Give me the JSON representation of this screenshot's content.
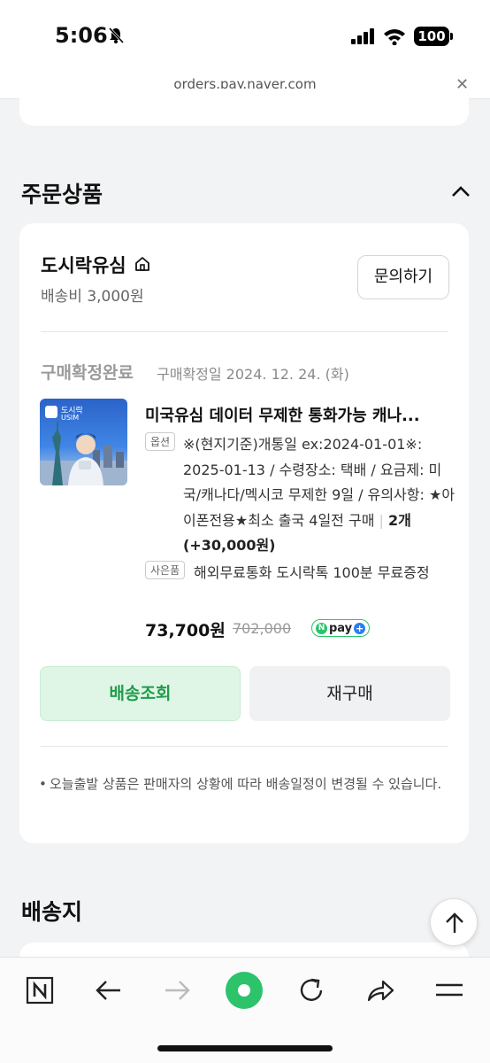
{
  "status_bar": {
    "time": "5:06",
    "battery": "100"
  },
  "browser": {
    "url": "orders.pay.naver.com"
  },
  "section": {
    "ordered_items": "주문상품",
    "delivery": "배송지"
  },
  "seller": {
    "name": "도시락유심",
    "shipping": "배송비 3,000원",
    "inquiry_label": "문의하기"
  },
  "order": {
    "status": "구매확정완료",
    "status_date": "구매확정일 2024. 12. 24. (화)",
    "thumb_brand": "도시락",
    "thumb_sub": "USIM",
    "product_name": "미국유심 데이터 무제한 통화가능 캐나...",
    "option_tag": "옵션",
    "option_text": "※(현지기준)개통일 ex:2024-01-01※: 2025-01-13 / 수령장소: 택배 / 요금제: 미국/캐나다/멕시코 무제한 9일 / 유의사항: ★아이폰전용★최소 출국 4일전 구매",
    "quantity": "2개 (+30,000원)",
    "gift_tag": "사은품",
    "gift_text": "해외무료통화 도시락톡 100분 무료증정",
    "price": "73,700원",
    "original_price": "702,000",
    "npay_label": "pay"
  },
  "actions": {
    "track_label": "배송조회",
    "rebuy_label": "재구매"
  },
  "notice": "오늘출발 상품은 판매자의 상황에 따라 배송일정이 변경될 수 있습니다.",
  "colors": {
    "green": "#2cc36b",
    "track_text": "#1f9d4a",
    "track_bg": "#dff6e6",
    "page_bg": "#f2f3f5"
  },
  "icons": {
    "home": "home-icon",
    "scroll_top": "arrow-up-icon",
    "nav": [
      "naver-n-icon",
      "back-arrow-icon",
      "forward-arrow-icon",
      "green-dot-icon",
      "reload-icon",
      "share-icon",
      "menu-icon"
    ]
  }
}
